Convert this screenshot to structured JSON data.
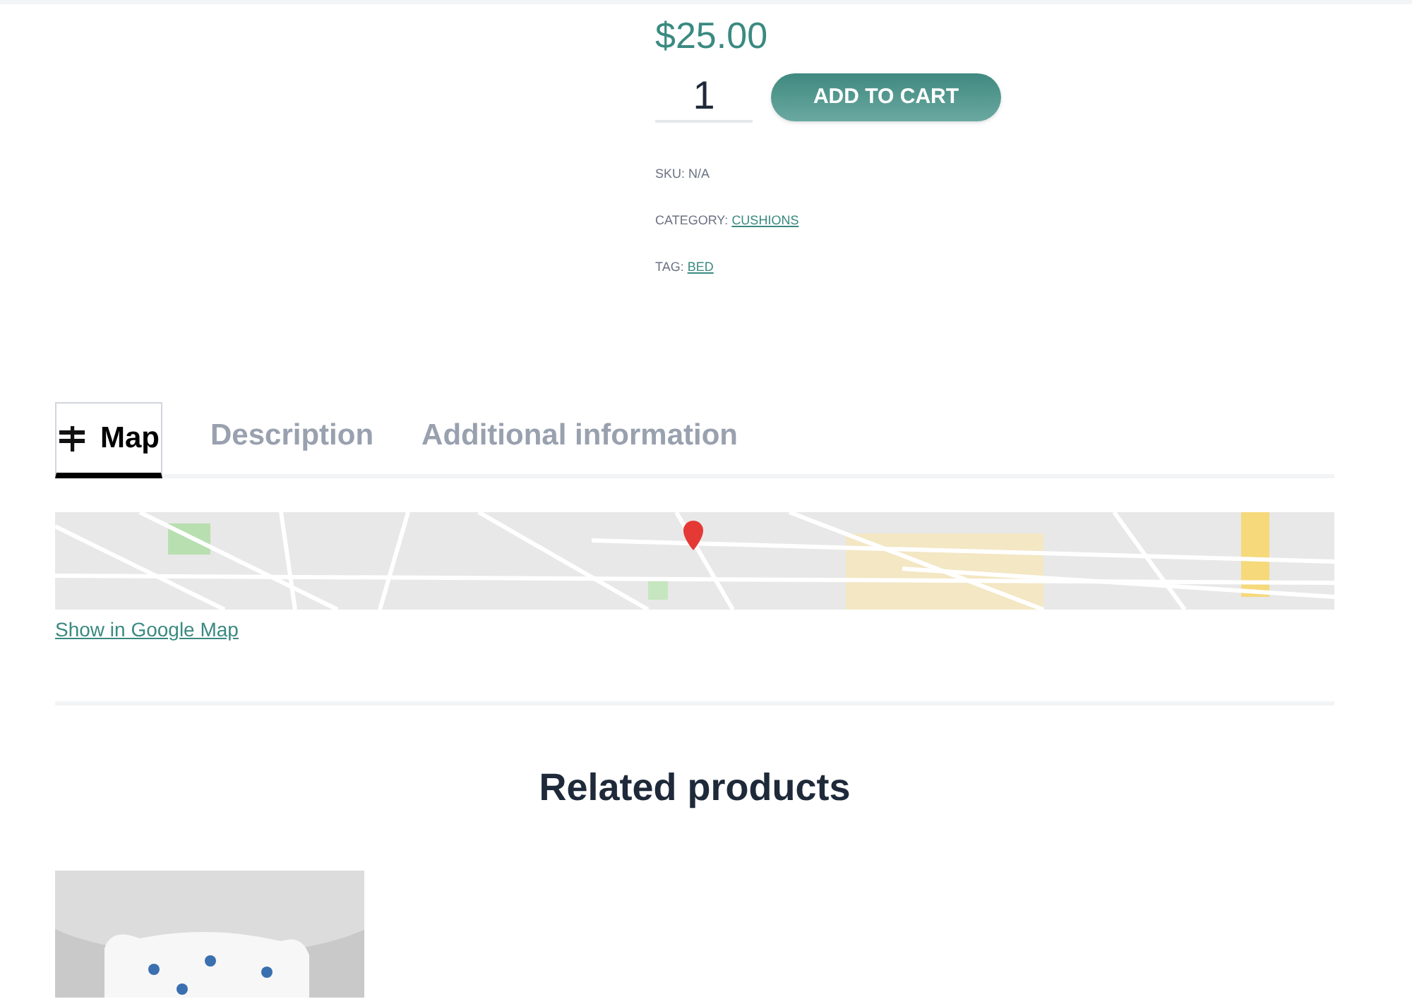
{
  "product": {
    "price": "$25.00",
    "quantity": "1",
    "add_to_cart": "ADD TO CART",
    "meta": [
      {
        "label": "SKU: ",
        "value": "N/A",
        "link": false
      },
      {
        "label": "CATEGORY: ",
        "value": "CUSHIONS",
        "link": true
      },
      {
        "label": "TAG: ",
        "value": "BED",
        "link": true
      }
    ]
  },
  "tabs": [
    {
      "label": "Map",
      "selected": true,
      "kind": "icon-tab"
    },
    {
      "label": "Description",
      "selected": false
    },
    {
      "label": "Additional information",
      "selected": false
    }
  ],
  "map": {
    "kind": "picture",
    "link": "Show in Google Map"
  },
  "related": {
    "title": "Related products"
  }
}
